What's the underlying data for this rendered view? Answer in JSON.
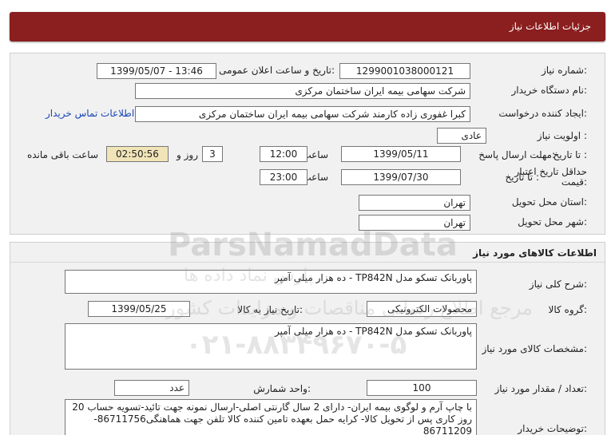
{
  "header": {
    "title": "جزئیات اطلاعات نیاز"
  },
  "details": {
    "need_number_label": "شماره نیاز:",
    "need_number": "1299001038000121",
    "announce_label": "تاریخ و ساعت اعلان عمومی:",
    "announce_value": "1399/05/07 - 13:46",
    "buyer_label": "نام دستگاه خریدار:",
    "buyer": "شرکت سهامی بیمه ایران ساختمان مرکزی",
    "creator_label": "ایجاد کننده درخواست:",
    "creator": "کبرا غفوری زاده کارمند شرکت سهامی بیمه ایران ساختمان مرکزی",
    "contact_link": "اطلاعات تماس خریدار",
    "priority_label": "اولویت نیاز :",
    "priority": "عادی",
    "deadline_label": "مهلت ارسال پاسخ:",
    "to_date_label": "تا تاریخ :",
    "deadline_date": "1399/05/11",
    "time_label": "ساعت",
    "deadline_time": "12:00",
    "days": "3",
    "days_label": "روز و",
    "remaining": "02:50:56",
    "remaining_label": "ساعت باقی مانده",
    "validity_label_1": "حداقل تاریخ اعتبار",
    "validity_label_2": "قیمت:",
    "validity_date": "1399/07/30",
    "validity_time": "23:00",
    "province_label": "استان محل تحویل:",
    "province": "تهران",
    "city_label": "شهر محل تحویل:",
    "city": "تهران"
  },
  "goods": {
    "title": "اطلاعات کالاهای مورد نیاز",
    "summary_label": "شرح کلی نیاز:",
    "summary": "پاوربانک تسکو مدل TP842N - ده هزار میلی آمپر",
    "group_label": "گروه کالا:",
    "group": "محصولات الکترونیکی",
    "need_date_label": "تاریخ نیاز به کالا:",
    "need_date": "1399/05/25",
    "spec_label": "مشخصات کالای مورد نیاز:",
    "spec": "پاوربانک تسکو مدل TP842N - ده هزار میلی آمپر",
    "unit_label": "واحد شمارش:",
    "unit": "عدد",
    "qty_label": "تعداد / مقدار مورد نیاز:",
    "qty": "100",
    "notes_label": "توضیحات خریدار:",
    "notes": "با چاپ آرم و لوگوی بیمه ایران- دارای 2 سال گارنتی اصلی-ارسال نمونه جهت تائید-تسویه حساب 20 روز کاری پس از تحویل کالا- کرایه حمل بعهده تامین کننده کالا تلفن جهت هماهنگی86711756-86711209"
  },
  "watermark": {
    "brand": "ParsNamadData",
    "brand_fa": "پارس نماد داده ها",
    "line2": "مرجع اطلاع رسانی مناقصات و مزایدات کشور",
    "phone": "۰۲۱-۸۸۳۴۹۶۷۰-۵"
  }
}
